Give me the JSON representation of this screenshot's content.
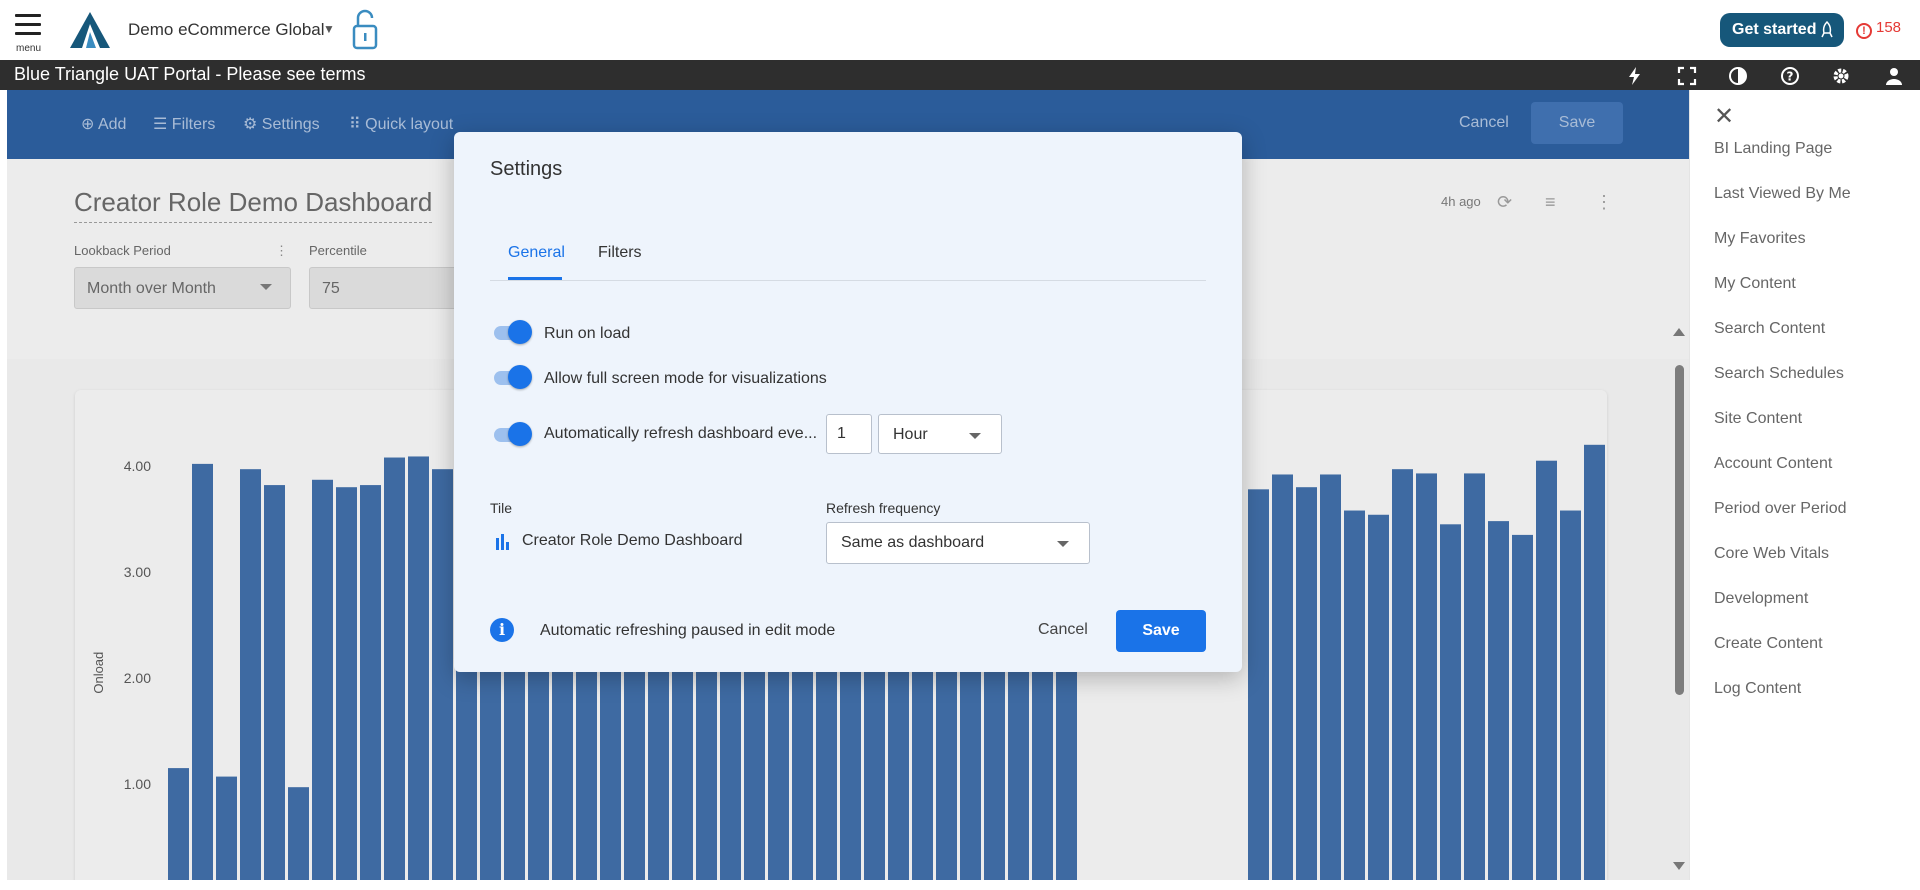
{
  "app": {
    "menu_label": "menu",
    "org_name": "Demo eCommerce Global",
    "get_started": "Get started",
    "alert_count": "158",
    "banner_title": "Blue Triangle UAT Portal - Please see terms"
  },
  "toolbar": {
    "add": "Add",
    "filters": "Filters",
    "settings": "Settings",
    "quick_layout": "Quick layout",
    "cancel": "Cancel",
    "save": "Save"
  },
  "dashboard": {
    "title": "Creator Role Demo Dashboard",
    "updated": "4h ago",
    "filters": [
      {
        "label": "Lookback Period",
        "value": "Month over Month"
      },
      {
        "label": "Percentile",
        "value": "75"
      }
    ]
  },
  "chart_data": {
    "type": "bar",
    "ylabel": "Onload",
    "ylim": [
      0,
      4.4
    ],
    "yticks": [
      "1.00",
      "2.00",
      "3.00",
      "4.00"
    ],
    "visible_left_values": [
      1.15,
      4.02,
      1.07,
      3.97,
      3.82,
      0.97,
      3.87,
      3.8,
      3.82,
      4.08,
      4.09,
      3.97,
      4.09
    ],
    "visible_right_values": [
      3.78,
      3.92,
      3.8,
      3.92,
      3.58,
      3.54,
      3.97,
      3.93,
      3.45,
      3.93,
      3.48,
      3.35,
      4.05,
      3.58,
      4.2
    ]
  },
  "sidebar": {
    "items": [
      "BI Landing Page",
      "Last Viewed By Me",
      "My Favorites",
      "My Content",
      "Search Content",
      "Search Schedules",
      "Site Content",
      "Account Content",
      "Period over Period",
      "Core Web Vitals",
      "Development",
      "Create Content",
      "Log Content"
    ]
  },
  "dialog": {
    "title": "Settings",
    "tabs": [
      "General",
      "Filters"
    ],
    "toggles": [
      {
        "label": "Run on load",
        "on": true
      },
      {
        "label": "Allow full screen mode for visualizations",
        "on": true
      },
      {
        "label": "Automatically refresh dashboard eve...",
        "on": true
      }
    ],
    "refresh_value": "1",
    "refresh_unit": "Hour",
    "tile_heading": "Tile",
    "tile_name": "Creator Role Demo Dashboard",
    "refresh_freq_heading": "Refresh frequency",
    "refresh_freq_value": "Same as dashboard",
    "info_text": "Automatic refreshing paused in edit mode",
    "cancel": "Cancel",
    "save": "Save"
  },
  "colors": {
    "brand": "#16577a",
    "accent": "#1a73e8",
    "bar": "#2b5c9a",
    "alert": "#e53935"
  }
}
